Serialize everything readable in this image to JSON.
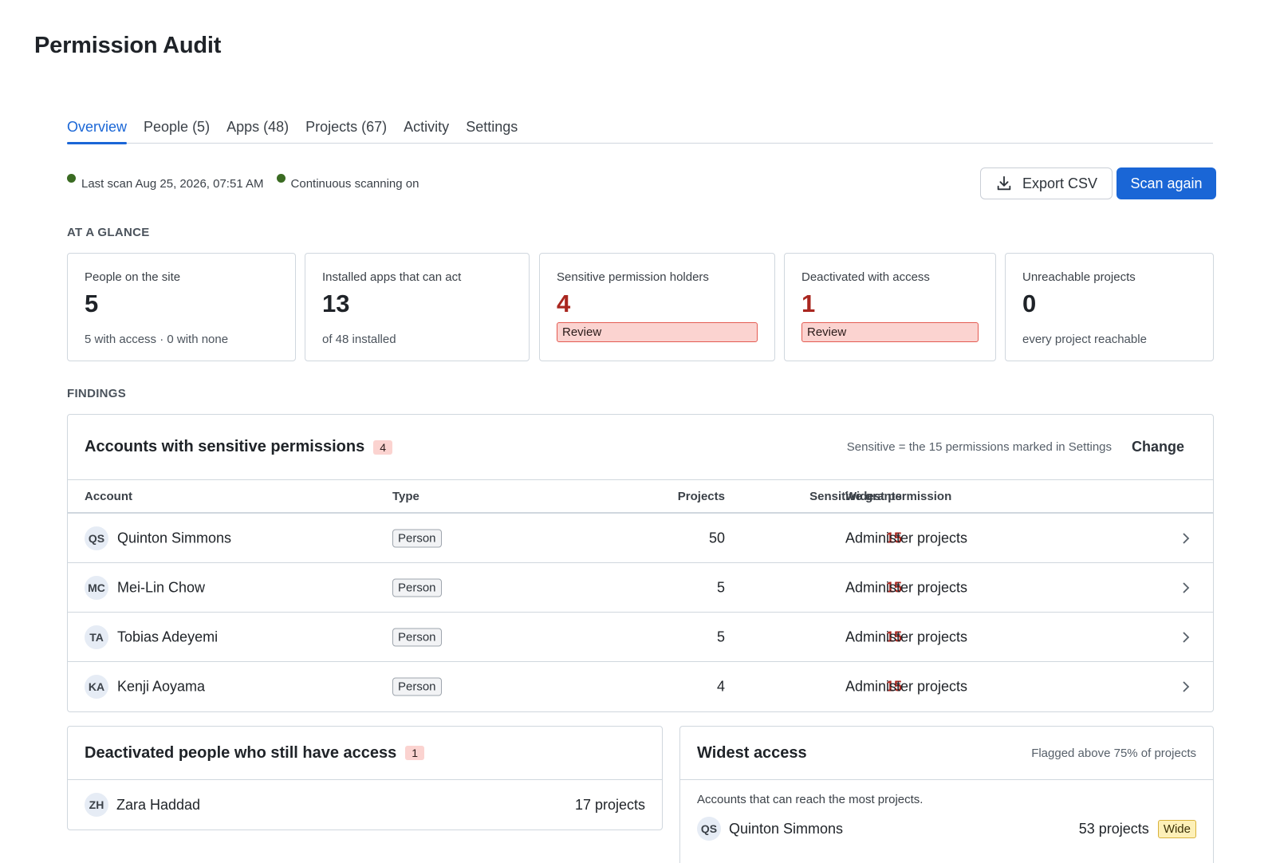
{
  "page": {
    "title": "Permission Audit"
  },
  "tabs": [
    {
      "label": "Overview",
      "active": true
    },
    {
      "label": "People (5)"
    },
    {
      "label": "Apps (48)"
    },
    {
      "label": "Projects (67)"
    },
    {
      "label": "Activity"
    },
    {
      "label": "Settings"
    }
  ],
  "status": {
    "last_scan": "Last scan Aug 25, 2026, 07:51 AM",
    "continuous": "Continuous scanning on",
    "dot_color": "#3a6b22"
  },
  "actions": {
    "export": "Export CSV",
    "scan": "Scan again",
    "accent": "#1a66d6"
  },
  "glance": {
    "label": "AT A GLANCE",
    "cards": [
      {
        "label": "People on the site",
        "value": "5",
        "sub": "5 with access · 0 with none"
      },
      {
        "label": "Installed apps that can act",
        "value": "13",
        "sub": "of 48 installed"
      },
      {
        "label": "Sensitive permission holders",
        "value": "4",
        "pill": "Review"
      },
      {
        "label": "Deactivated with access",
        "value": "1",
        "pill": "Review"
      },
      {
        "label": "Unreachable projects",
        "value": "0",
        "sub": "every project reachable"
      }
    ]
  },
  "findings": {
    "label": "FINDINGS",
    "sensitive": {
      "title": "Accounts with sensitive permissions",
      "count": "4",
      "note": "Sensitive = the 15 permissions marked in Settings",
      "change": "Change",
      "columns": {
        "account": "Account",
        "type": "Type",
        "projects": "Projects",
        "grants": "Sensitive grants",
        "widest": "Widest permission"
      },
      "rows": [
        {
          "initials": "QS",
          "name": "Quinton Simmons",
          "type": "Person",
          "projects": "50",
          "grants": "15",
          "widest": "Administer projects"
        },
        {
          "initials": "MC",
          "name": "Mei-Lin Chow",
          "type": "Person",
          "projects": "5",
          "grants": "15",
          "widest": "Administer projects"
        },
        {
          "initials": "TA",
          "name": "Tobias Adeyemi",
          "type": "Person",
          "projects": "5",
          "grants": "15",
          "widest": "Administer projects"
        },
        {
          "initials": "KA",
          "name": "Kenji Aoyama",
          "type": "Person",
          "projects": "4",
          "grants": "15",
          "widest": "Administer projects"
        }
      ]
    },
    "deactivated": {
      "title": "Deactivated people who still have access",
      "count": "1",
      "rows": [
        {
          "initials": "ZH",
          "name": "Zara Haddad",
          "projects": "17 projects"
        }
      ]
    },
    "widest": {
      "title": "Widest access",
      "note": "Flagged above 75% of projects",
      "desc": "Accounts that can reach the most projects.",
      "rows": [
        {
          "initials": "QS",
          "name": "Quinton Simmons",
          "projects": "53 projects",
          "flag": "Wide"
        }
      ]
    }
  }
}
